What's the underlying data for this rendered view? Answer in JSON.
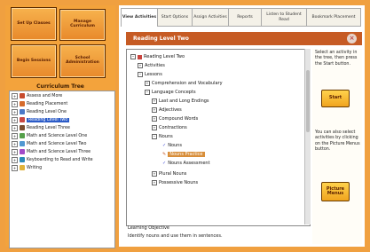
{
  "left_panel": {
    "buttons": [
      "Set Up Classes",
      "Manage Curriculum",
      "Begin Sessions",
      "School Administration"
    ],
    "tree_title": "Curriculum Tree",
    "tree_items": [
      "Assess and More",
      "Reading Placement",
      "Reading Level One",
      "Reading Level Two",
      "Reading Level Three",
      "Math and Science Level One",
      "Math and Science Level Two",
      "Math and Science Level Three",
      "Keyboarding to Read and Write",
      "Writing"
    ]
  },
  "tabs": [
    "View Activities",
    "Start Options",
    "Assign Activities",
    "Reports",
    "Listen to Student Read",
    "Bookmark Placement"
  ],
  "panel": {
    "title": "Reading Level Two",
    "items": [
      "Reading Level Two",
      "Activities",
      "Lessons",
      "Comprehension and Vocabulary",
      "Language Concepts",
      "Last and Long Endings",
      "Adjectives",
      "Compound Words",
      "Contractions",
      "Nouns",
      "Nouns",
      "Nouns Practice",
      "Nouns Assessment",
      "Plural Nouns",
      "Possessive Nouns"
    ],
    "objective_label": "Learning Objective",
    "objective_text": "Identify nouns and use them in sentences."
  },
  "instructions": {
    "text1": "Select an activity in the tree, then press the Start button.",
    "start": "Start",
    "text2": "You can also select activities by clicking on the Picture Menus button.",
    "picture": "Picture Menus"
  }
}
